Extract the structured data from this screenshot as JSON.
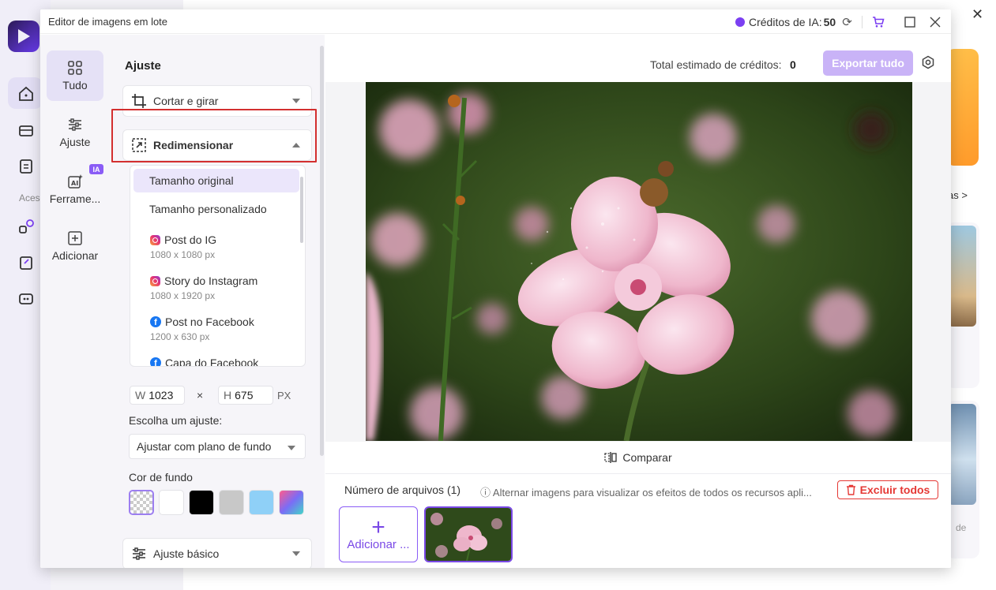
{
  "background": {
    "accessibility_label": "Aces",
    "more_link": "as >",
    "card_text": "de"
  },
  "dialog": {
    "title": "Editor de imagens em lote",
    "credits_label": "Créditos de IA:",
    "credits_value": "50"
  },
  "nav": {
    "items": [
      {
        "label": "Tudo",
        "icon": "grid-icon"
      },
      {
        "label": "Ajuste",
        "icon": "sliders-icon"
      },
      {
        "label": "Ferrame...",
        "icon": "ai-tools-icon",
        "badge": "IA"
      },
      {
        "label": "Adicionar",
        "icon": "add-box-icon"
      }
    ]
  },
  "panel": {
    "title": "Ajuste",
    "crop_label": "Cortar e girar",
    "resize_label": "Redimensionar",
    "resize_options": [
      {
        "name": "Tamanho original"
      },
      {
        "name": "Tamanho personalizado"
      },
      {
        "name": "Post do IG",
        "size": "1080 x 1080 px"
      },
      {
        "name": "Story do Instagram",
        "size": "1080 x 1920 px"
      },
      {
        "name": "Post no Facebook",
        "size": "1200 x 630 px"
      },
      {
        "name": "Capa do Facebook"
      }
    ],
    "width_label": "W",
    "width_value": "1023",
    "times": "×",
    "height_label": "H",
    "height_value": "675",
    "unit": "PX",
    "fit_label": "Escolha um ajuste:",
    "fit_value": "Ajustar com plano de fundo",
    "bg_color_label": "Cor de fundo",
    "swatches": [
      "transparent",
      "#ffffff",
      "#000000",
      "#c8c8c8",
      "#8fd0f7",
      "gradient"
    ],
    "basic_label": "Ajuste básico"
  },
  "main": {
    "total_label": "Total estimado de créditos:",
    "total_value": "0",
    "export_label": "Exportar tudo",
    "compare_label": "Comparar",
    "files_label": "Número de arquivos (1)",
    "files_hint": "ⓘ Alternar imagens para visualizar os efeitos de todos os recursos apli...",
    "delete_label": "Excluir todos",
    "add_label": "Adicionar ..."
  }
}
